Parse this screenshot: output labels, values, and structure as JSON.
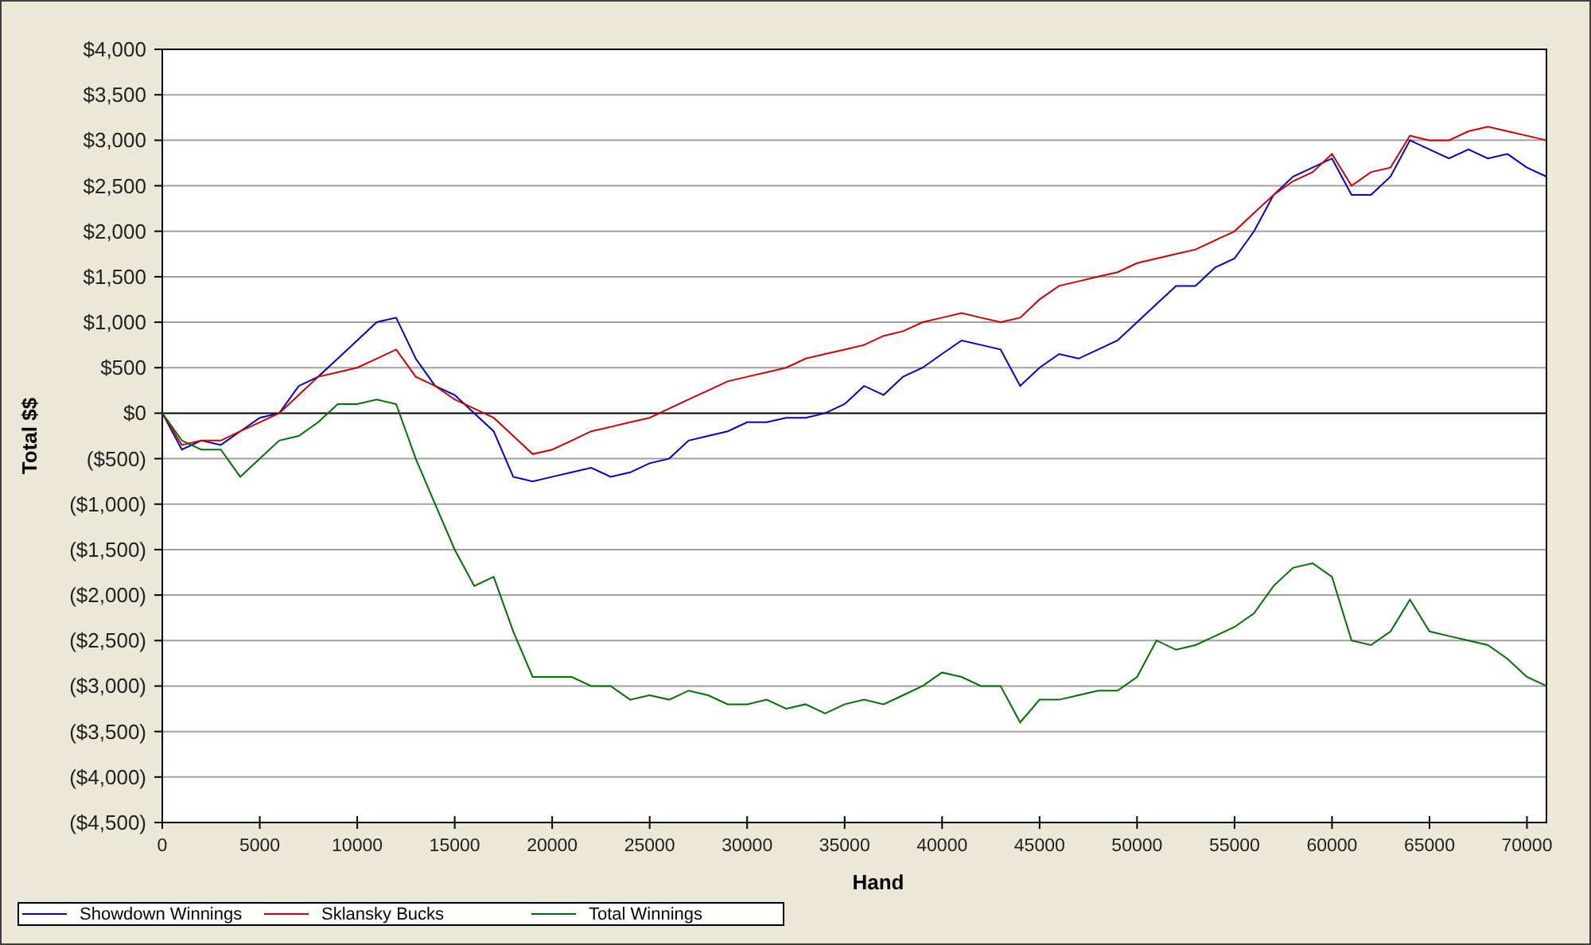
{
  "chart": {
    "chart_data": {
      "type": "line",
      "grid": true,
      "xlabel": "Hand",
      "ylabel": "Total $$",
      "xlim": [
        0,
        71000
      ],
      "ylim": [
        -4500,
        4000
      ],
      "xticks": [
        0,
        5000,
        10000,
        15000,
        20000,
        25000,
        30000,
        35000,
        40000,
        45000,
        50000,
        55000,
        60000,
        65000,
        70000
      ],
      "yticks": [
        {
          "value": 4000,
          "label": "$4,000"
        },
        {
          "value": 3500,
          "label": "$3,500"
        },
        {
          "value": 3000,
          "label": "$3,000"
        },
        {
          "value": 2500,
          "label": "$2,500"
        },
        {
          "value": 2000,
          "label": "$2,000"
        },
        {
          "value": 1500,
          "label": "$1,500"
        },
        {
          "value": 1000,
          "label": "$1,000"
        },
        {
          "value": 500,
          "label": "$500"
        },
        {
          "value": 0,
          "label": "$0"
        },
        {
          "value": -500,
          "label": "($500)"
        },
        {
          "value": -1000,
          "label": "($1,000)"
        },
        {
          "value": -1500,
          "label": "($1,500)"
        },
        {
          "value": -2000,
          "label": "($2,000)"
        },
        {
          "value": -2500,
          "label": "($2,500)"
        },
        {
          "value": -3000,
          "label": "($3,000)"
        },
        {
          "value": -3500,
          "label": "($3,500)"
        },
        {
          "value": -4000,
          "label": "($4,000)"
        },
        {
          "value": -4500,
          "label": "($4,500)"
        }
      ],
      "x": [
        0,
        1000,
        2000,
        3000,
        4000,
        5000,
        6000,
        7000,
        8000,
        9000,
        10000,
        11000,
        12000,
        13000,
        14000,
        15000,
        16000,
        17000,
        18000,
        19000,
        20000,
        21000,
        22000,
        23000,
        24000,
        25000,
        26000,
        27000,
        28000,
        29000,
        30000,
        31000,
        32000,
        33000,
        34000,
        35000,
        36000,
        37000,
        38000,
        39000,
        40000,
        41000,
        42000,
        43000,
        44000,
        45000,
        46000,
        47000,
        48000,
        49000,
        50000,
        51000,
        52000,
        53000,
        54000,
        55000,
        56000,
        57000,
        58000,
        59000,
        60000,
        61000,
        62000,
        63000,
        64000,
        65000,
        66000,
        67000,
        68000,
        69000,
        70000,
        71000
      ],
      "series": [
        {
          "name": "Showdown Winnings",
          "color": "#0000c0",
          "values": [
            0,
            -400,
            -300,
            -350,
            -200,
            -50,
            0,
            300,
            400,
            600,
            800,
            1000,
            1050,
            600,
            300,
            200,
            0,
            -200,
            -700,
            -750,
            -700,
            -650,
            -600,
            -700,
            -650,
            -550,
            -500,
            -300,
            -250,
            -200,
            -100,
            -100,
            -50,
            -50,
            0,
            100,
            300,
            200,
            400,
            500,
            650,
            800,
            750,
            700,
            300,
            500,
            650,
            600,
            700,
            800,
            1000,
            1200,
            1400,
            1400,
            1600,
            1700,
            2000,
            2400,
            2600,
            2700,
            2800,
            2400,
            2400,
            2600,
            3000,
            2900,
            2800,
            2900,
            2800,
            2850,
            2700,
            2600
          ]
        },
        {
          "name": "Sklansky Bucks",
          "color": "#d00000",
          "values": [
            0,
            -350,
            -300,
            -300,
            -200,
            -100,
            0,
            200,
            400,
            450,
            500,
            600,
            700,
            400,
            300,
            150,
            50,
            -50,
            -250,
            -450,
            -400,
            -300,
            -200,
            -150,
            -100,
            -50,
            50,
            150,
            250,
            350,
            400,
            450,
            500,
            600,
            650,
            700,
            750,
            850,
            900,
            1000,
            1050,
            1100,
            1050,
            1000,
            1050,
            1250,
            1400,
            1450,
            1500,
            1550,
            1650,
            1700,
            1750,
            1800,
            1900,
            2000,
            2200,
            2400,
            2550,
            2650,
            2850,
            2500,
            2650,
            2700,
            3050,
            3000,
            3000,
            3100,
            3150,
            3100,
            3050,
            3000
          ]
        },
        {
          "name": "Total Winnings",
          "color": "#007000",
          "values": [
            0,
            -300,
            -400,
            -400,
            -700,
            -500,
            -300,
            -250,
            -100,
            100,
            100,
            150,
            100,
            -500,
            -1000,
            -1500,
            -1900,
            -1800,
            -2400,
            -2900,
            -2900,
            -2900,
            -3000,
            -3000,
            -3150,
            -3100,
            -3150,
            -3050,
            -3100,
            -3200,
            -3200,
            -3150,
            -3250,
            -3200,
            -3300,
            -3200,
            -3150,
            -3200,
            -3100,
            -3000,
            -2850,
            -2900,
            -3000,
            -3000,
            -3400,
            -3150,
            -3150,
            -3100,
            -3050,
            -3050,
            -2900,
            -2500,
            -2600,
            -2550,
            -2450,
            -2350,
            -2200,
            -1900,
            -1700,
            -1650,
            -1800,
            -2500,
            -2550,
            -2400,
            -2050,
            -2400,
            -2450,
            -2500,
            -2550,
            -2700,
            -2900,
            -3000
          ]
        }
      ]
    }
  }
}
